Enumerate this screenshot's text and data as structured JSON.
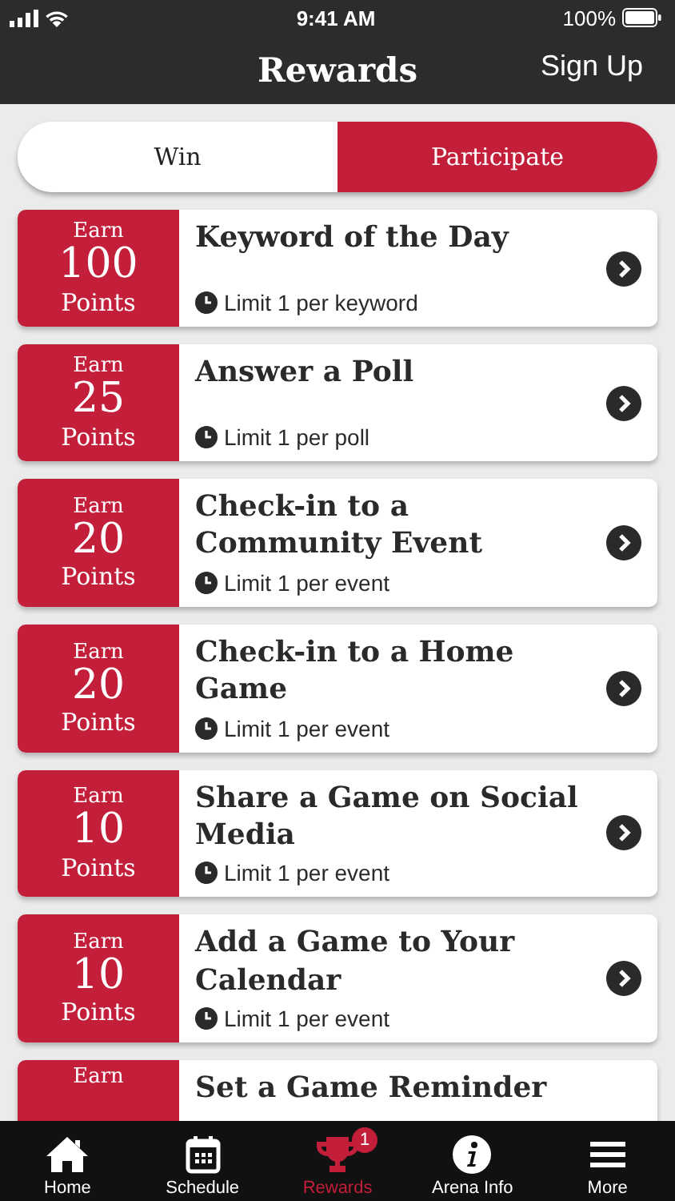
{
  "status_bar": {
    "time": "9:41 AM",
    "battery": "100%"
  },
  "header": {
    "title": "Rewards",
    "action": "Sign Up"
  },
  "segments": [
    {
      "label": "Win",
      "selected": false
    },
    {
      "label": "Participate",
      "selected": true
    }
  ],
  "rewards": [
    {
      "earn": "Earn",
      "points": "100",
      "unit": "Points",
      "title": "Keyword of the Day",
      "limit": "Limit 1 per keyword"
    },
    {
      "earn": "Earn",
      "points": "25",
      "unit": "Points",
      "title": "Answer a Poll",
      "limit": "Limit 1 per poll"
    },
    {
      "earn": "Earn",
      "points": "20",
      "unit": "Points",
      "title": "Check-in to a Community Event",
      "limit": "Limit 1 per event"
    },
    {
      "earn": "Earn",
      "points": "20",
      "unit": "Points",
      "title": "Check-in to a Home Game",
      "limit": "Limit 1 per event"
    },
    {
      "earn": "Earn",
      "points": "10",
      "unit": "Points",
      "title": "Share a Game on Social Media",
      "limit": "Limit 1 per event"
    },
    {
      "earn": "Earn",
      "points": "10",
      "unit": "Points",
      "title": "Add a Game to Your Calendar",
      "limit": "Limit 1 per event"
    },
    {
      "earn": "Earn",
      "title": "Set a Game Reminder"
    }
  ],
  "tab_bar": [
    {
      "kind": "home",
      "label": "Home",
      "selected": false
    },
    {
      "kind": "calendar",
      "label": "Schedule",
      "selected": false
    },
    {
      "kind": "trophy",
      "label": "Rewards",
      "selected": true,
      "badge": "1"
    },
    {
      "kind": "info",
      "label": "Arena Info",
      "selected": false
    },
    {
      "kind": "menu",
      "label": "More",
      "selected": false
    }
  ]
}
